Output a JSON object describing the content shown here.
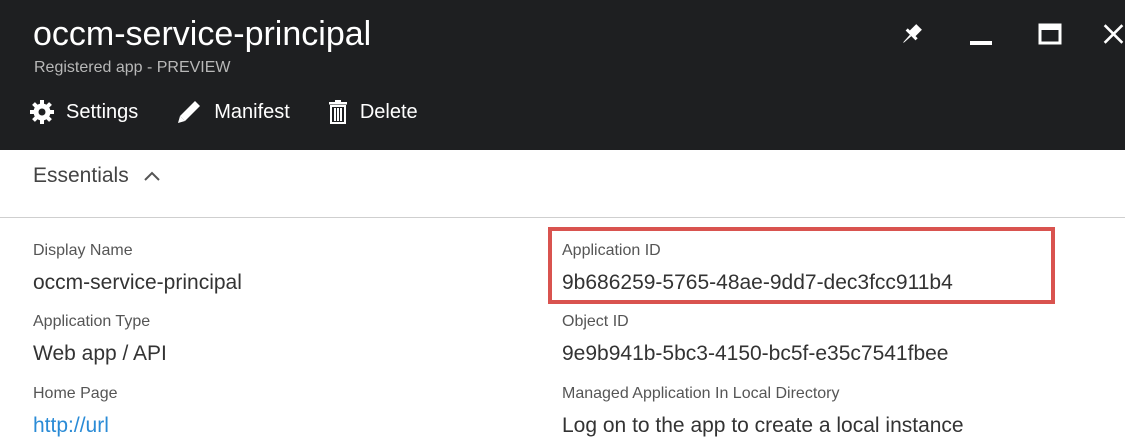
{
  "header": {
    "title": "occm-service-principal",
    "subtitle": "Registered app - PREVIEW"
  },
  "window_controls": {
    "pin_icon": "pin-icon",
    "minimize_icon": "minimize-icon",
    "maximize_icon": "maximize-icon",
    "close_icon": "close-icon"
  },
  "toolbar": {
    "settings_label": "Settings",
    "manifest_label": "Manifest",
    "delete_label": "Delete"
  },
  "essentials": {
    "label": "Essentials",
    "chevron_icon": "chevron-up-icon"
  },
  "properties": {
    "display_name": {
      "label": "Display Name",
      "value": "occm-service-principal"
    },
    "application_type": {
      "label": "Application Type",
      "value": "Web app / API"
    },
    "home_page": {
      "label": "Home Page",
      "value": "http://url"
    },
    "application_id": {
      "label": "Application ID",
      "value": "9b686259-5765-48ae-9dd7-dec3fcc911b4"
    },
    "object_id": {
      "label": "Object ID",
      "value": "9e9b941b-5bc3-4150-bc5f-e35c7541fbee"
    },
    "managed_app": {
      "label": "Managed Application In Local Directory",
      "value": "Log on to the app to create a local instance"
    }
  },
  "colors": {
    "header_bg": "#1e1f21",
    "link": "#2a8bd6",
    "highlight_border": "#d9534f"
  }
}
